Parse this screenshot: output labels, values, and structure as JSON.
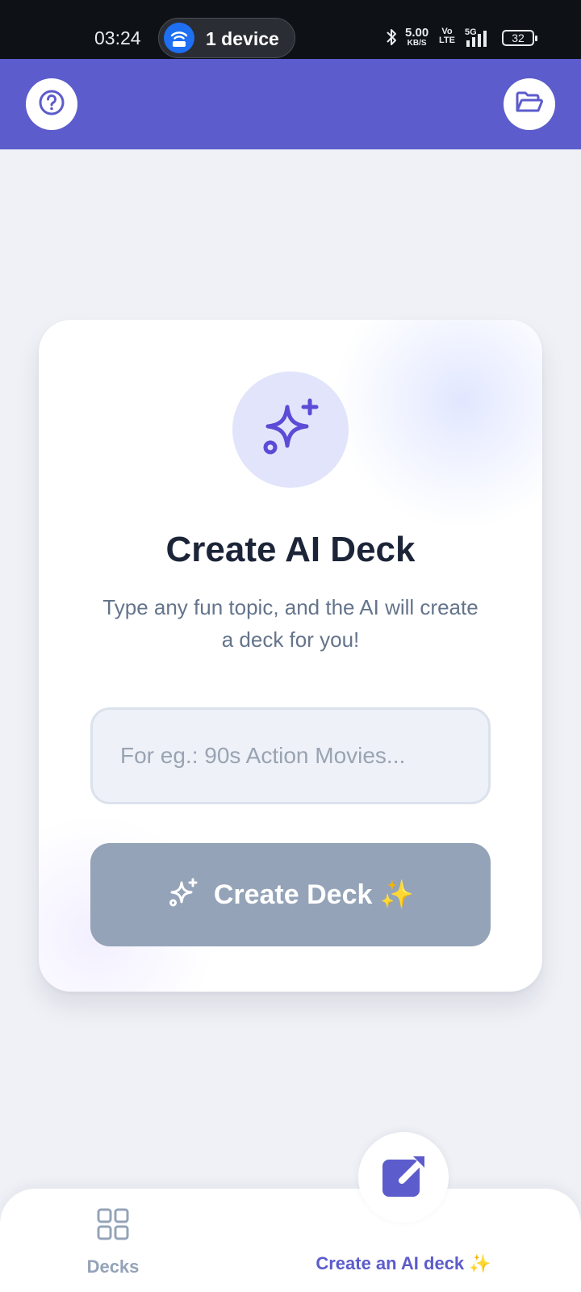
{
  "status_bar": {
    "time": "03:24",
    "hotspot_label": "1 device",
    "net_speed": "5.00",
    "net_speed_unit": "KB/S",
    "volte": "Vo",
    "volte_sub": "LTE",
    "network": "5G",
    "battery": "32"
  },
  "app_bar": {
    "help_icon": "question-circle-icon",
    "folder_icon": "folder-open-icon",
    "color": "#5c5ccc"
  },
  "card": {
    "icon": "sparkles-icon",
    "title": "Create AI Deck",
    "subtitle": "Type any fun topic, and the AI will create a deck for you!",
    "input": {
      "value": "",
      "placeholder": "For eg.: 90s Action Movies..."
    },
    "button_label": "Create Deck ✨",
    "button_color": "#94a3b8"
  },
  "bottom_nav": {
    "decks_label": "Decks",
    "ai_deck_label": "Create an AI deck ✨",
    "active_item": "ai_deck",
    "active_color": "#5c5ccc",
    "inactive_color": "#94a3b8"
  }
}
